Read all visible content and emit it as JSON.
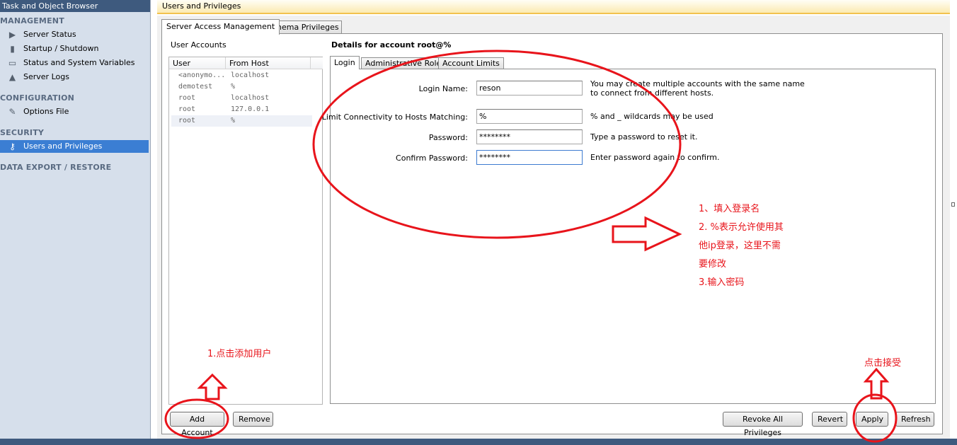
{
  "sidebar": {
    "title": "Task and Object Browser",
    "sections": {
      "management": "MANAGEMENT",
      "configuration": "CONFIGURATION",
      "security": "SECURITY",
      "data_export": "DATA EXPORT / RESTORE"
    },
    "items": {
      "server_status": "Server Status",
      "startup_shutdown": "Startup / Shutdown",
      "status_variables": "Status and System Variables",
      "server_logs": "Server Logs",
      "options_file": "Options File",
      "users_privileges": "Users and Privileges"
    },
    "icons": {
      "server_status": "play-circle-icon",
      "startup_shutdown": "power-switch-icon",
      "status_variables": "monitor-icon",
      "server_logs": "warning-icon",
      "options_file": "wrench-icon",
      "users_privileges": "key-icon"
    }
  },
  "header": {
    "title": "Users and Privileges"
  },
  "tabs": {
    "server_access": "Server Access Management",
    "schema_privileges": "Schema Privileges"
  },
  "accounts": {
    "label": "User Accounts",
    "columns": {
      "user": "User",
      "host": "From Host"
    },
    "rows": [
      {
        "user": "<anonymo...",
        "host": "localhost"
      },
      {
        "user": "demotest",
        "host": "%"
      },
      {
        "user": "root",
        "host": "localhost"
      },
      {
        "user": "root",
        "host": "127.0.0.1"
      },
      {
        "user": "root",
        "host": "%"
      }
    ]
  },
  "details": {
    "title": "Details for account root@%",
    "tabs": {
      "login": "Login",
      "admin_roles": "Administrative Roles",
      "account_limits": "Account Limits"
    },
    "fields": {
      "login_name": {
        "label": "Login Name:",
        "value": "reson",
        "hint1": "You may create multiple accounts with the same name",
        "hint2": "to connect from different hosts."
      },
      "limit_hosts": {
        "label": "Limit Connectivity to Hosts Matching:",
        "value": "%",
        "hint": "% and _ wildcards may be used"
      },
      "password": {
        "label": "Password:",
        "value": "********",
        "hint": "Type a password to reset it."
      },
      "confirm_password": {
        "label": "Confirm Password:",
        "value": "********",
        "hint": "Enter password again to confirm."
      }
    }
  },
  "buttons": {
    "add_account": "Add Account",
    "remove": "Remove",
    "revoke_all": "Revoke All Privileges",
    "revert": "Revert",
    "apply": "Apply",
    "refresh": "Refresh"
  },
  "annotations": {
    "right_lines": [
      "1、填入登录名",
      "2. %表示允许使用其",
      "他ip登录，这里不需",
      "要修改",
      "3.输入密码"
    ],
    "add_user": "1.点击添加用户",
    "accept": "点击接受",
    "color": "#e8141b"
  }
}
